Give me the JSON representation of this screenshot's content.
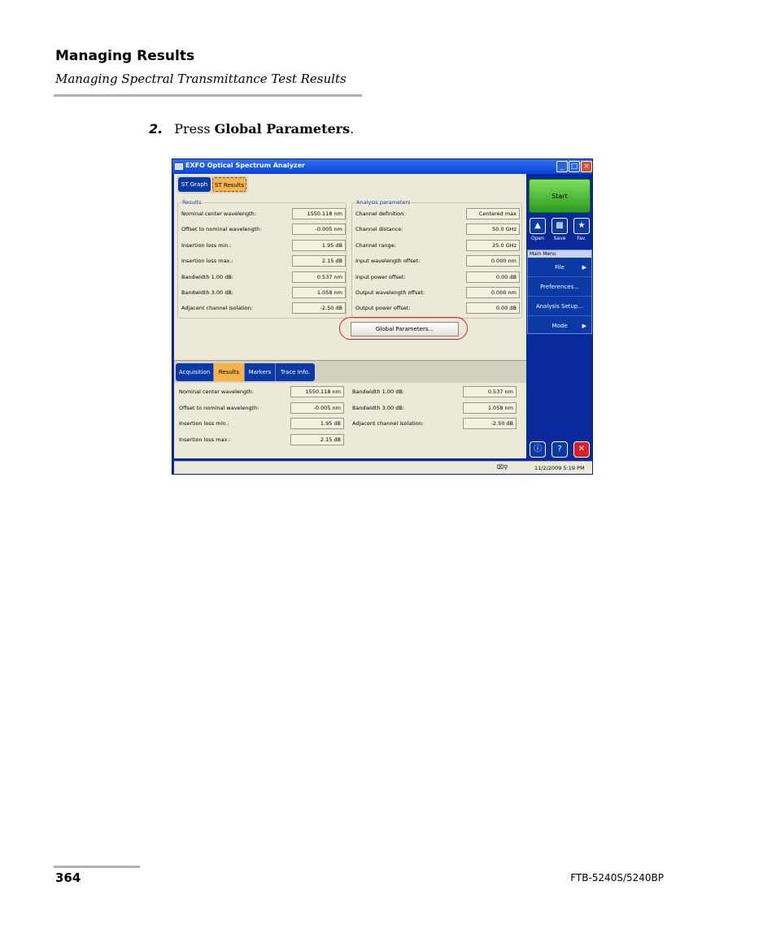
{
  "header": {
    "title": "Managing Results",
    "subtitle": "Managing Spectral Transmittance Test Results"
  },
  "step": {
    "number": "2.",
    "prefix": "Press ",
    "bold": "Global Parameters",
    "suffix": "."
  },
  "footer": {
    "page": "364",
    "model": "FTB-5240S/5240BP"
  },
  "app": {
    "title": "EXFO Optical Spectrum Analyzer",
    "window_buttons": [
      "_",
      "□",
      "×"
    ],
    "top_tabs": [
      "ST Graph",
      "ST Results"
    ],
    "results_group": "Results",
    "results": [
      {
        "label": "Nominal center wavelength:",
        "value": "1550.118 nm"
      },
      {
        "label": "Offset to nominal wavelength:",
        "value": "-0.005 nm"
      },
      {
        "label": "Insertion loss min.:",
        "value": "1.95 dB"
      },
      {
        "label": "Insertion loss max.:",
        "value": "2.15 dB"
      },
      {
        "label": "Bandwidth 1.00 dB:",
        "value": "0.537 nm"
      },
      {
        "label": "Bandwidth 3.00 dB:",
        "value": "1.058 nm"
      },
      {
        "label": "Adjacent channel isolation:",
        "value": "-2.50 dB"
      }
    ],
    "analysis_group": "Analysis parameters",
    "analysis": [
      {
        "label": "Channel definition:",
        "value": "Centered max"
      },
      {
        "label": "Channel distance:",
        "value": "50.0 GHz"
      },
      {
        "label": "Channel range:",
        "value": "25.0 GHz"
      },
      {
        "label": "Input wavelength offset:",
        "value": "0.000 nm"
      },
      {
        "label": "Input power offset:",
        "value": "0.00 dB"
      },
      {
        "label": "Output wavelength offset:",
        "value": "0.000 nm"
      },
      {
        "label": "Output power offset:",
        "value": "0.00 dB"
      }
    ],
    "global_button": "Global Parameters...",
    "bottom_tabs": [
      "Acquisition",
      "Results",
      "Markers",
      "Trace Info."
    ],
    "bottom_left": [
      {
        "label": "Nominal center wavelength:",
        "value": "1550.118 nm"
      },
      {
        "label": "Offset to nominal wavelength:",
        "value": "-0.005 nm"
      },
      {
        "label": "Insertion loss min.:",
        "value": "1.95 dB"
      },
      {
        "label": "Insertion loss max.:",
        "value": "2.15 dB"
      }
    ],
    "bottom_right": [
      {
        "label": "Bandwidth 1.00 dB:",
        "value": "0.537 nm"
      },
      {
        "label": "Bandwidth 3.00 dB:",
        "value": "1.058 nm"
      },
      {
        "label": "Adjacent channel isolation:",
        "value": "-2.50 dB"
      }
    ],
    "sidebar": {
      "start": "Start",
      "icons": [
        "Open",
        "Save",
        "Fav."
      ],
      "menu_title": "Main Menu",
      "menu": [
        "File",
        "Preferences...",
        "Analysis Setup...",
        "Mode"
      ]
    },
    "status_time": "11/2/2009 5:19 PM"
  },
  "colors": {
    "accent": "#0b3aa6",
    "selected_tab": "#f7b24a",
    "start": "#4cc23a",
    "highlight_ring": "#d8202a"
  }
}
